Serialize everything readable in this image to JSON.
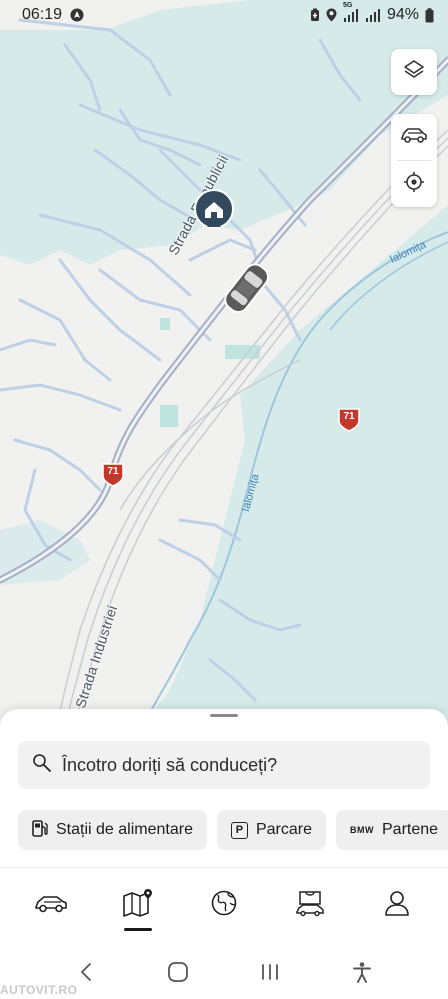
{
  "status_bar": {
    "time": "06:19",
    "battery": "94%",
    "network": "5G",
    "icons": [
      "navigation-icon",
      "battery-saver-icon",
      "location-icon",
      "signal-icon",
      "signal-icon",
      "battery-icon"
    ]
  },
  "map": {
    "streets": {
      "republicii": "Strada Republicii",
      "industriei": "Strada Industriei"
    },
    "river_labels": [
      "Ialomița",
      "Ialomița"
    ],
    "road_shields": [
      "71",
      "71"
    ],
    "controls": [
      "layers-icon",
      "car-icon",
      "locate-icon"
    ],
    "colors": {
      "water": "#d6eaea",
      "land": "#f1f1ef",
      "road": "#b5c4dd",
      "main_road": "#a9b0c8",
      "pin": "#334a5e"
    }
  },
  "sheet": {
    "search_placeholder": "Încotro doriți să conduceți?",
    "chips": [
      {
        "label": "Stații de alimentare",
        "icon": "fuel-pump-icon"
      },
      {
        "label": "Parcare",
        "icon": "parking-icon"
      },
      {
        "label": "Partene",
        "icon": "bmw-logo-icon",
        "icon_text": "BMW"
      }
    ],
    "tabs": [
      {
        "icon": "car-icon",
        "active": false
      },
      {
        "icon": "map-icon",
        "active": true
      },
      {
        "icon": "globe-icon",
        "active": false
      },
      {
        "icon": "shop-icon",
        "active": false
      },
      {
        "icon": "profile-icon",
        "active": false
      }
    ]
  },
  "system_nav": [
    "back-icon",
    "home-icon",
    "recents-icon",
    "accessibility-icon"
  ],
  "watermark": "AUTOVIT.RO"
}
